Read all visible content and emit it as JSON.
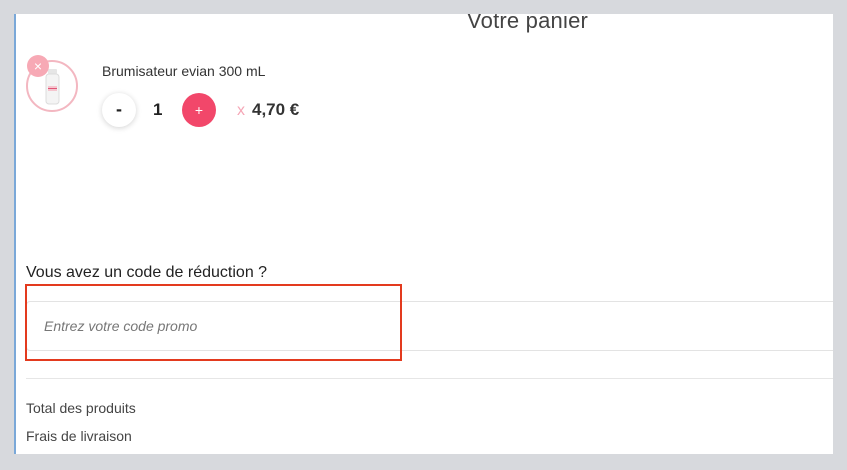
{
  "cart": {
    "title": "Votre panier",
    "items": [
      {
        "name": "Brumisateur evian 300 mL",
        "quantity": "1",
        "times": "x",
        "unit_price": "4,70 €",
        "remove_icon": "×",
        "minus_label": "-",
        "plus_label": "+"
      }
    ]
  },
  "promo": {
    "label": "Vous avez un code de réduction ?",
    "placeholder": "Entrez votre code promo",
    "value": ""
  },
  "summary": {
    "total_label": "Total des produits",
    "shipping_label": "Frais de livraison"
  },
  "colors": {
    "accent": "#f2476a",
    "accent_light": "#f7a9b5",
    "highlight": "#e33a1e",
    "background": "#d7d9dd"
  }
}
